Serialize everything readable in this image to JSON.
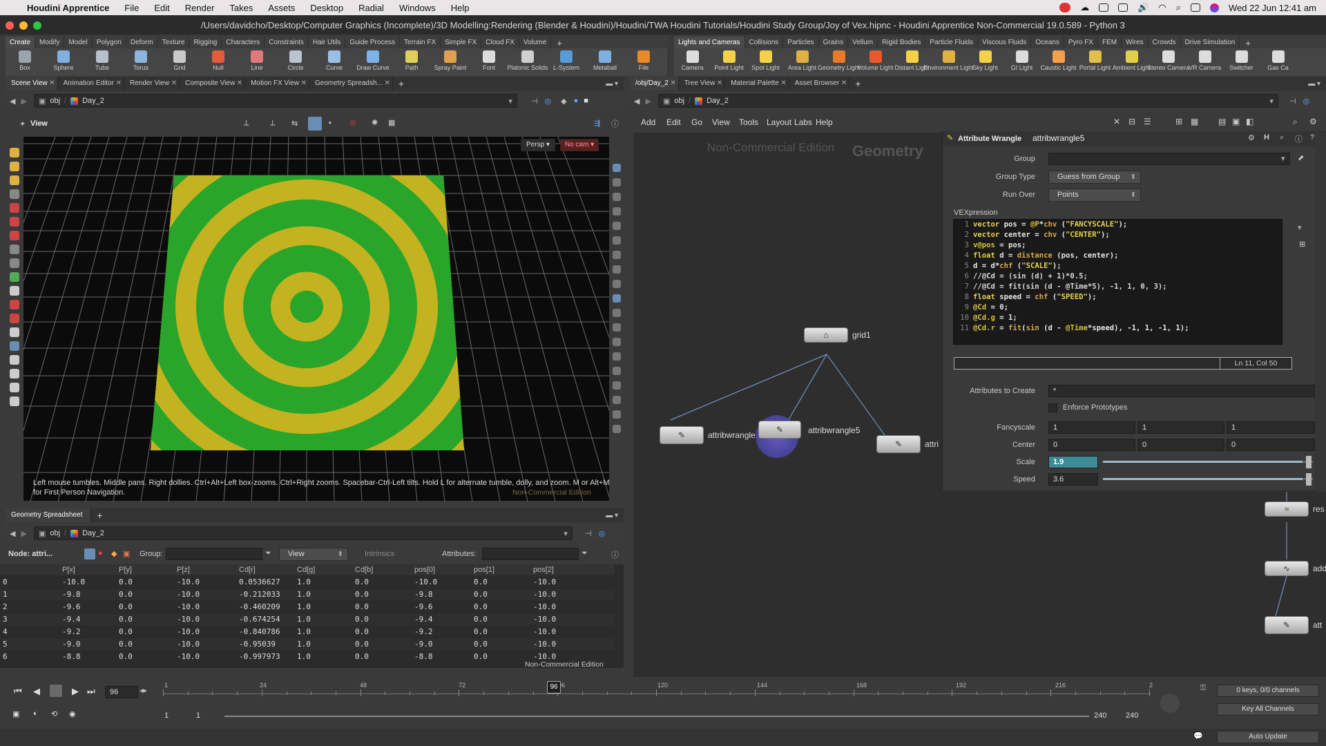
{
  "menubar": {
    "apple": "",
    "app": "Houdini Apprentice",
    "items": [
      "File",
      "Edit",
      "Render",
      "Takes",
      "Assets",
      "Desktop",
      "Radial",
      "Windows",
      "Help"
    ],
    "datetime": "Wed 22 Jun  12:41 am"
  },
  "window": {
    "title": "/Users/davidcho/Desktop/Computer Graphics (Incomplete)/3D Modelling:Rendering (Blender & Houdini)/Houdini/TWA Houdini Tutorials/Houdini Study Group/Joy of Vex.hipnc - Houdini Apprentice Non-Commercial 19.0.589 - Python 3"
  },
  "shelf_left": {
    "tabs": [
      "Create",
      "Modify",
      "Model",
      "Polygon",
      "Deform",
      "Texture",
      "Rigging",
      "Characters",
      "Constraints",
      "Hair Utils",
      "Guide Process",
      "Terrain FX",
      "Simple FX",
      "Cloud FX",
      "Volume"
    ],
    "tools": [
      "Box",
      "Sphere",
      "Tube",
      "Torus",
      "Grid",
      "Null",
      "Line",
      "Circle",
      "Curve",
      "Draw Curve",
      "Path",
      "Spray Paint",
      "Font",
      "Platonic Solids",
      "L-System",
      "Metaball",
      "File"
    ]
  },
  "shelf_right": {
    "tabs": [
      "Lights and Cameras",
      "Collisions",
      "Particles",
      "Grains",
      "Vellum",
      "Rigid Bodies",
      "Particle Fluids",
      "Viscous Fluids",
      "Oceans",
      "Pyro FX",
      "FEM",
      "Wires",
      "Crowds",
      "Drive Simulation"
    ],
    "tools": [
      "Camera",
      "Point Light",
      "Spot Light",
      "Area Light",
      "Geometry Light",
      "Volume Light",
      "Distant Light",
      "Environment Light",
      "Sky Light",
      "GI Light",
      "Caustic Light",
      "Portal Light",
      "Ambient Light",
      "Stereo Camera",
      "VR Camera",
      "Switcher",
      "Gas Ca"
    ]
  },
  "left_panes": {
    "tabs": [
      "Scene View",
      "Animation Editor",
      "Render View",
      "Composite View",
      "Motion FX View",
      "Geometry Spreadsh..."
    ],
    "path_obj": "obj",
    "path_node": "Day_2",
    "view_label": "View"
  },
  "viewport": {
    "persp": "Persp",
    "cam": "No cam",
    "help": "Left mouse tumbles. Middle pans. Right dollies. Ctrl+Alt+Left box-zooms. Ctrl+Right zooms. Spacebar-Ctrl-Left tilts. Hold L for alternate tumble, dolly, and zoom.    M or Alt+M for First Person Navigation.",
    "watermark": "Non-Commercial Edition"
  },
  "right_panes": {
    "tabs": [
      "/obj/Day_2",
      "Tree View",
      "Material Palette",
      "Asset Browser"
    ],
    "path_obj": "obj",
    "path_node": "Day_2",
    "menu": [
      "Add",
      "Edit",
      "Go",
      "View",
      "Tools",
      "Layout",
      "Labs",
      "Help"
    ],
    "watermark": "Non-Commercial Edition",
    "context": "Geometry"
  },
  "params": {
    "type": "Attribute Wrangle",
    "name": "attribwrangle5",
    "group_label": "Group",
    "group_value": "",
    "group_type_label": "Group Type",
    "group_type": "Guess from Group",
    "run_over_label": "Run Over",
    "run_over": "Points",
    "vex_label": "VEXpression",
    "cursor": "Ln 11, Col 50",
    "attrs_label": "Attributes to Create",
    "attrs_value": "*",
    "enforce": "Enforce Prototypes",
    "fancy_label": "Fancyscale",
    "fancy": [
      "1",
      "1",
      "1"
    ],
    "center_label": "Center",
    "center": [
      "0",
      "0",
      "0"
    ],
    "scale_label": "Scale",
    "scale": "1.9",
    "scale_frac": 0.95,
    "speed_label": "Speed",
    "speed": "3.6",
    "speed_frac": 0.95
  },
  "code": [
    "vector pos = @P*chv (\"FANCYSCALE\");",
    "vector center = chv (\"CENTER\");",
    "v@pos = pos;",
    "float d = distance (pos, center);",
    "d = d*chf (\"SCALE\");",
    "//@Cd = (sin (d) + 1)*0.5;",
    "//@Cd = fit(sin (d - @Time*5), -1, 1, 0, 3);",
    "float speed = chf (\"SPEED\");",
    "@Cd = 0;",
    "@Cd.g = 1;",
    "@Cd.r = fit(sin (d - @Time*speed), -1, 1, -1, 1);"
  ],
  "nodes": {
    "grid": "grid1",
    "w_left": "attribwrangle",
    "w_sel": "attribwrangle5",
    "w_right": "attri",
    "r1": "res",
    "r2": "add",
    "r3": "att"
  },
  "spreadsheet": {
    "tab": "Geometry Spreadsheet",
    "path_obj": "obj",
    "path_node": "Day_2",
    "node_label": "Node: attri...",
    "group_label": "Group:",
    "view_label": "View",
    "intrinsics": "Intrinsics",
    "attributes_label": "Attributes:",
    "columns": [
      "",
      "P[x]",
      "P[y]",
      "P[z]",
      "Cd[r]",
      "Cd[g]",
      "Cd[b]",
      "pos[0]",
      "pos[1]",
      "pos[2]"
    ],
    "rows": [
      [
        "0",
        "-10.0",
        "0.0",
        "-10.0",
        "0.0536627",
        "1.0",
        "0.0",
        "-10.0",
        "0.0",
        "-10.0"
      ],
      [
        "1",
        "-9.8",
        "0.0",
        "-10.0",
        "-0.212033",
        "1.0",
        "0.0",
        "-9.8",
        "0.0",
        "-10.0"
      ],
      [
        "2",
        "-9.6",
        "0.0",
        "-10.0",
        "-0.460209",
        "1.0",
        "0.0",
        "-9.6",
        "0.0",
        "-10.0"
      ],
      [
        "3",
        "-9.4",
        "0.0",
        "-10.0",
        "-0.674254",
        "1.0",
        "0.0",
        "-9.4",
        "0.0",
        "-10.0"
      ],
      [
        "4",
        "-9.2",
        "0.0",
        "-10.0",
        "-0.840786",
        "1.0",
        "0.0",
        "-9.2",
        "0.0",
        "-10.0"
      ],
      [
        "5",
        "-9.0",
        "0.0",
        "-10.0",
        "-0.95039",
        "1.0",
        "0.0",
        "-9.0",
        "0.0",
        "-10.0"
      ],
      [
        "6",
        "-8.8",
        "0.0",
        "-10.0",
        "-0.997973",
        "1.0",
        "0.0",
        "-8.8",
        "0.0",
        "-10.0"
      ]
    ],
    "watermark": "Non-Commercial Edition"
  },
  "timeline": {
    "frame": "96",
    "ticks": [
      "1",
      "24",
      "48",
      "72",
      "96",
      "120",
      "144",
      "168",
      "192",
      "216",
      "2"
    ],
    "start": "1",
    "start2": "1",
    "end": "240",
    "end2": "240",
    "keys": "0 keys, 0/0 channels",
    "key_all": "Key All Channels",
    "auto_update": "Auto Update"
  }
}
